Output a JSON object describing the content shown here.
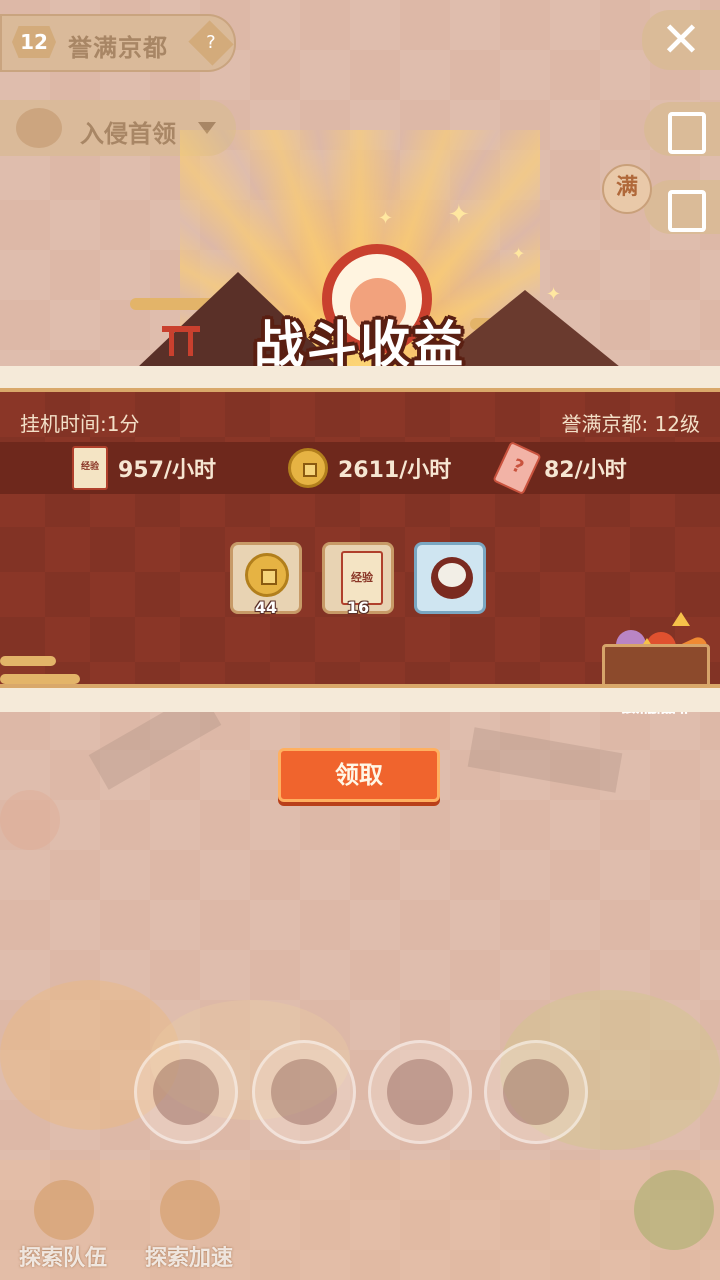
{
  "hud": {
    "stage_number": "12",
    "stage_name": "誉满京都",
    "help_glyph": "?",
    "invade_label": "入侵首领",
    "close_glyph": "✕",
    "full_badge": "满"
  },
  "header": {
    "title": "战斗收益"
  },
  "panel": {
    "afk_time": "挂机时间:1分",
    "region_level": "誉满京都: 12级",
    "rates": [
      {
        "icon": "exp-scroll-icon",
        "icon_text": "经验",
        "value": "957/小时"
      },
      {
        "icon": "coin-icon",
        "value": "2611/小时"
      },
      {
        "icon": "ticket-icon",
        "icon_text": "?",
        "value": "82/小时"
      }
    ],
    "rewards": [
      {
        "icon": "coin-icon",
        "count": "44"
      },
      {
        "icon": "exp-scroll-icon",
        "icon_text": "经验",
        "count": "16"
      },
      {
        "icon": "noodle-bowl-icon",
        "count": ""
      }
    ],
    "food_multiplier_label": "食材倍率"
  },
  "claim_button": "领取",
  "bottom_nav": {
    "team_label": "探索队伍",
    "speedup_label": "探索加速"
  },
  "colors": {
    "panel": "#8a3627",
    "strip": "#6e281c",
    "claim": "#f0642d",
    "gold": "#e3b469"
  }
}
